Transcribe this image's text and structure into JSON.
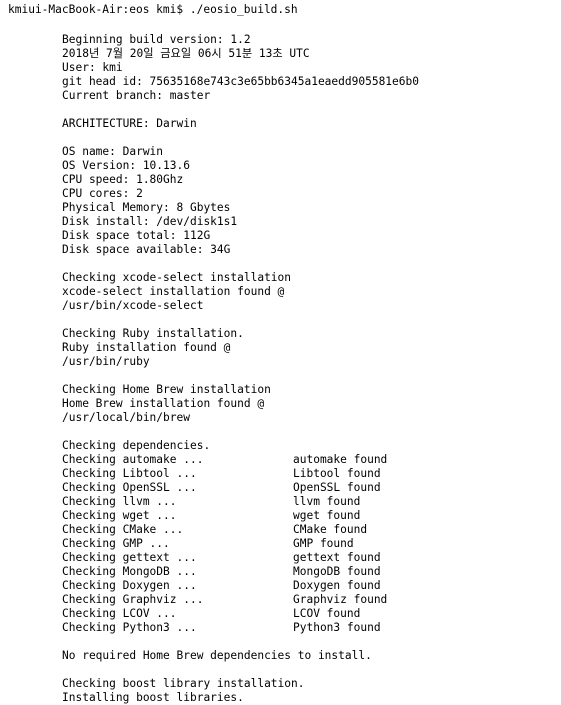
{
  "terminal": {
    "prompt": "kmiui-MacBook-Air:eos kmi$ ./eosio_build.sh"
  },
  "output": {
    "header": [
      "Beginning build version: 1.2",
      "2018년 7월 20일 금요일 06시 51분 13초 UTC",
      "User: kmi",
      "git head id: 75635168e743c3e65bb6345a1eaedd905581e6b0",
      "Current branch: master"
    ],
    "architecture": "ARCHITECTURE: Darwin",
    "system": [
      "OS name: Darwin",
      "OS Version: 10.13.6",
      "CPU speed: 1.80Ghz",
      "CPU cores: 2",
      "Physical Memory: 8 Gbytes",
      "Disk install: /dev/disk1s1",
      "Disk space total: 112G",
      "Disk space available: 34G"
    ],
    "xcode": [
      "Checking xcode-select installation",
      "xcode-select installation found @",
      "/usr/bin/xcode-select"
    ],
    "ruby": [
      "Checking Ruby installation.",
      "Ruby installation found @",
      "/usr/bin/ruby"
    ],
    "brew": [
      "Checking Home Brew installation",
      "Home Brew installation found @",
      "/usr/local/bin/brew"
    ],
    "deps_heading": "Checking dependencies.",
    "deps": [
      {
        "check": "Checking automake ...",
        "found": "automake found"
      },
      {
        "check": "Checking Libtool ...",
        "found": "Libtool found"
      },
      {
        "check": "Checking OpenSSL ...",
        "found": "OpenSSL found"
      },
      {
        "check": "Checking llvm ...",
        "found": "llvm found"
      },
      {
        "check": "Checking wget ...",
        "found": "wget found"
      },
      {
        "check": "Checking CMake ...",
        "found": "CMake found"
      },
      {
        "check": "Checking GMP ...",
        "found": "GMP found"
      },
      {
        "check": "Checking gettext ...",
        "found": "gettext found"
      },
      {
        "check": "Checking MongoDB ...",
        "found": "MongoDB found"
      },
      {
        "check": "Checking Doxygen ...",
        "found": "Doxygen found"
      },
      {
        "check": "Checking Graphviz ...",
        "found": "Graphviz found"
      },
      {
        "check": "Checking LCOV ...",
        "found": "LCOV found"
      },
      {
        "check": "Checking Python3 ...",
        "found": "Python3 found"
      }
    ],
    "no_deps": "No required Home Brew dependencies to install.",
    "boost": [
      "Checking boost library installation.",
      "Installing boost libraries."
    ]
  }
}
